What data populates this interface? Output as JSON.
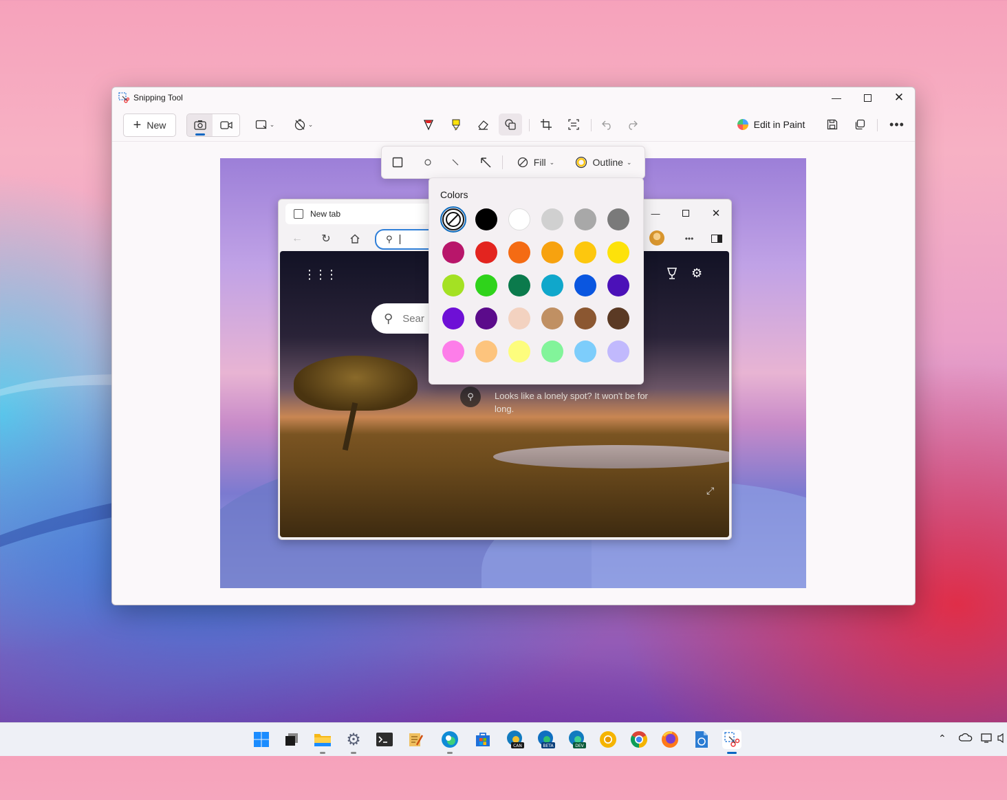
{
  "window": {
    "title": "Snipping Tool",
    "app_icon": "scissors-icon"
  },
  "toolbar": {
    "new_label": "New",
    "edit_in_paint_label": "Edit in Paint"
  },
  "shape_toolbar": {
    "fill_label": "Fill",
    "outline_label": "Outline"
  },
  "colors_popup": {
    "title": "Colors",
    "swatches": [
      "none",
      "#000000",
      "#ffffff",
      "#d0d0d0",
      "#a8a8a8",
      "#7a7a7a",
      "#b8166a",
      "#e3241f",
      "#f46b13",
      "#f7a20f",
      "#fdc70e",
      "#fde20a",
      "#a4e123",
      "#2fd31b",
      "#0b7a4c",
      "#10a7cb",
      "#0a56e0",
      "#4b11b8",
      "#6e10d6",
      "#5b0b8b",
      "#f3d2c0",
      "#c09063",
      "#8b5731",
      "#5b3a24",
      "#fd7de9",
      "#fdc47d",
      "#fdfd7d",
      "#82f49a",
      "#7dcdfb",
      "#c1b9fd"
    ]
  },
  "captured_browser": {
    "tab_title": "New tab",
    "search_placeholder": "Sear",
    "caption": "Looks like a lonely spot? It won't be for long."
  },
  "taskbar": {
    "icons": [
      "windows-start-icon",
      "task-view-icon",
      "file-explorer-icon",
      "settings-icon",
      "terminal-icon",
      "notepad-icon",
      "edge-icon",
      "store-icon",
      "edge-canary-icon",
      "edge-beta-icon",
      "edge-dev-icon",
      "chrome-canary-icon",
      "chrome-icon",
      "firefox-icon",
      "word-icon",
      "snipping-tool-icon"
    ],
    "canary_badge": "CAN",
    "beta_badge": "BETA",
    "dev_badge": "DEV"
  }
}
